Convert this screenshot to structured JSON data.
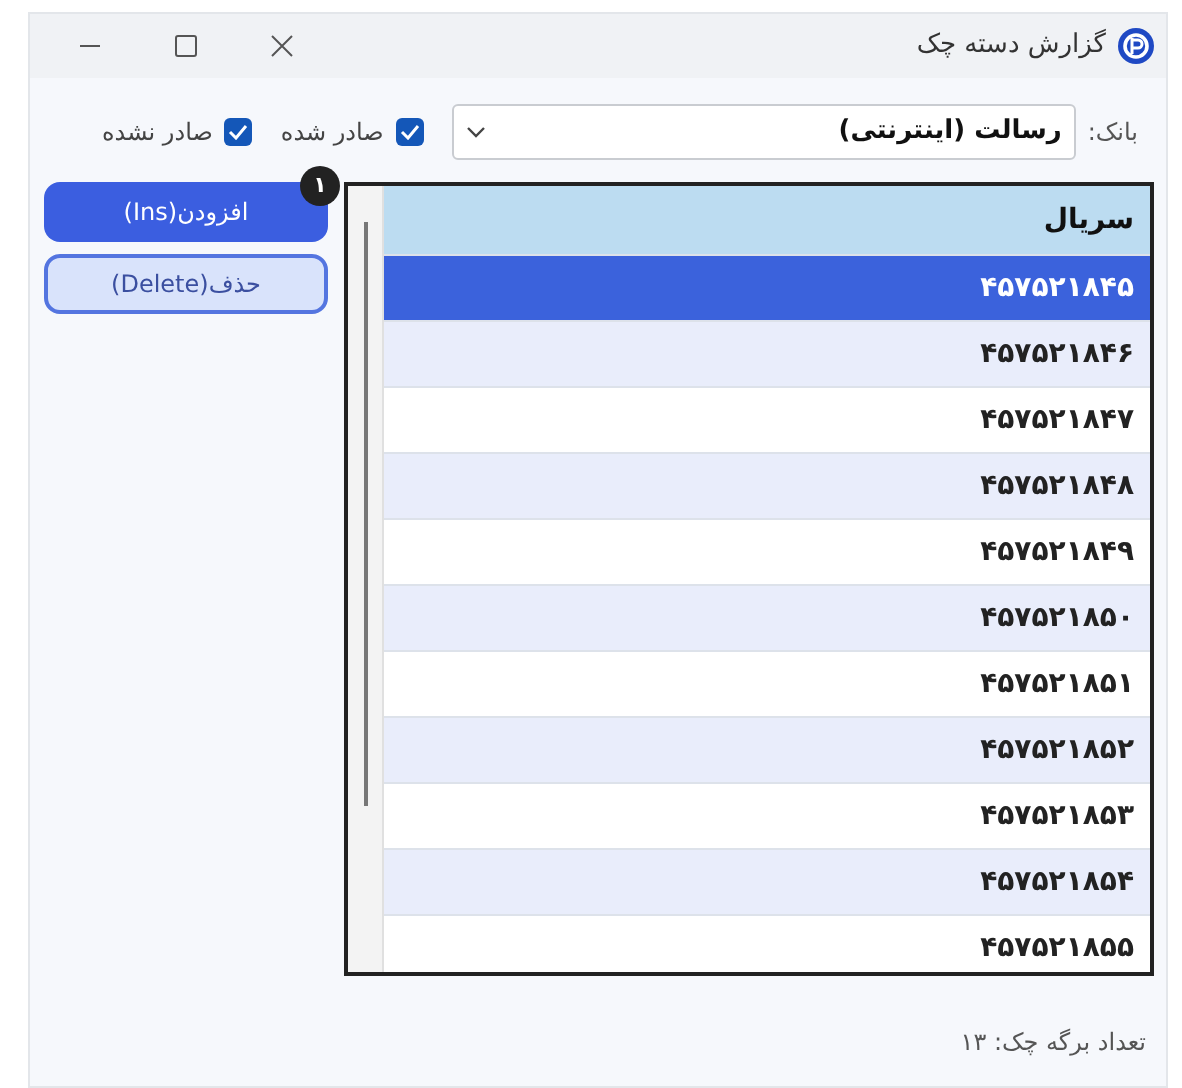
{
  "window": {
    "title": "گزارش دسته چک"
  },
  "filter": {
    "bank_label": "بانک:",
    "bank_select": {
      "value": "رسالت (اینترنتی)"
    },
    "checkboxes": [
      {
        "label": "صادر شده",
        "checked": true
      },
      {
        "label": "صادر نشده",
        "checked": true
      }
    ]
  },
  "buttons": [
    {
      "label": "افزودن(Ins)",
      "kind": "primary",
      "badge": "۱"
    },
    {
      "label": "حذف(Delete)",
      "kind": "secondary"
    }
  ],
  "table": {
    "columns": [
      "سریال"
    ],
    "rows": [
      {
        "serial": "۴۵۷۵۲۱۸۴۵",
        "selected": true
      },
      {
        "serial": "۴۵۷۵۲۱۸۴۶",
        "selected": false
      },
      {
        "serial": "۴۵۷۵۲۱۸۴۷",
        "selected": false
      },
      {
        "serial": "۴۵۷۵۲۱۸۴۸",
        "selected": false
      },
      {
        "serial": "۴۵۷۵۲۱۸۴۹",
        "selected": false
      },
      {
        "serial": "۴۵۷۵۲۱۸۵۰",
        "selected": false
      },
      {
        "serial": "۴۵۷۵۲۱۸۵۱",
        "selected": false
      },
      {
        "serial": "۴۵۷۵۲۱۸۵۲",
        "selected": false
      },
      {
        "serial": "۴۵۷۵۲۱۸۵۳",
        "selected": false
      },
      {
        "serial": "۴۵۷۵۲۱۸۵۴",
        "selected": false
      },
      {
        "serial": "۴۵۷۵۲۱۸۵۵",
        "selected": false
      }
    ]
  },
  "status_bar": {
    "text": "تعداد برگه چک: ۱۳"
  }
}
